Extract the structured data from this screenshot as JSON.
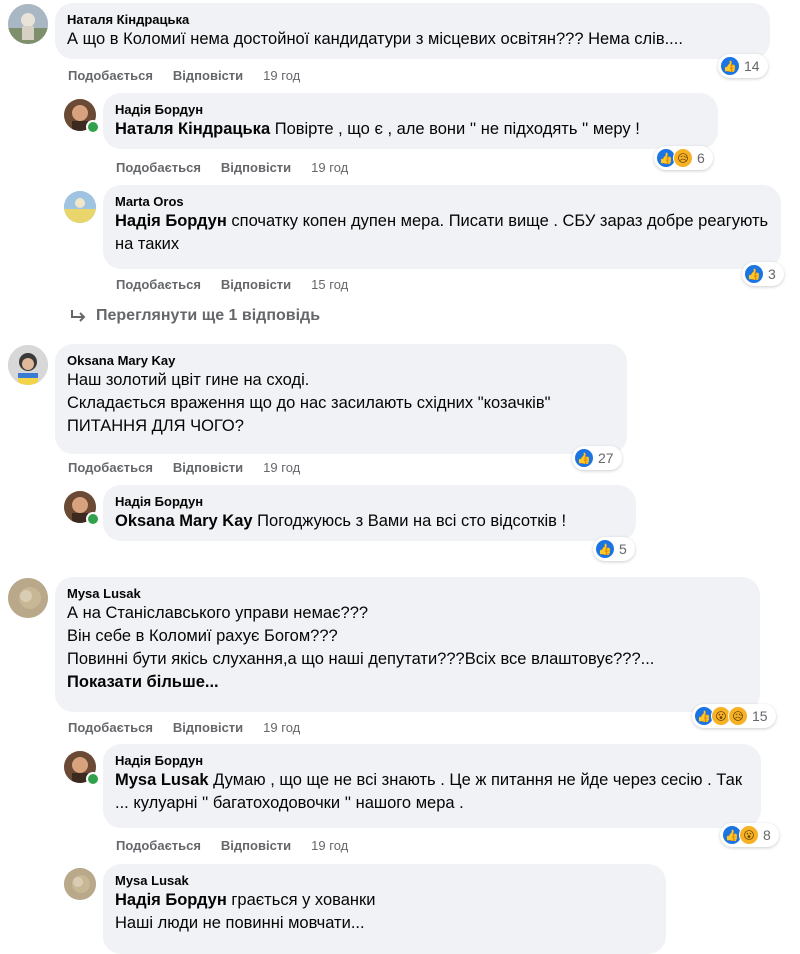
{
  "labels": {
    "like": "Подобається",
    "reply": "Відповісти"
  },
  "view_more_replies": "Переглянути ще 1 відповідь",
  "see_more": "Показати більше...",
  "comments": [
    {
      "author": "Наталя Кіндрацька",
      "text": "А що в Коломиї нема достойної кандидатури з місцевих освітян??? Нема слів....",
      "time": "19 год",
      "reactions": [
        "like"
      ],
      "reaction_count": "14"
    },
    {
      "author": "Надія Бордун",
      "mention": "Наталя Кіндрацька",
      "text": " Повірте , що є , але вони '' не підходять '' меру !",
      "time": "19 год",
      "reactions": [
        "like",
        "sad"
      ],
      "reaction_count": "6"
    },
    {
      "author": "Marta Oros",
      "mention": "Надія Бордун",
      "text": " спочатку копен дупен мера. Писати вище . СБУ зараз добре реагують на таких",
      "time": "15 год",
      "reactions": [
        "like"
      ],
      "reaction_count": "3"
    },
    {
      "author": "Oksana Mary Kay",
      "text": "Наш золотий цвіт гине на сході.\nСкладається враження що до нас засилають східних \"козачків\"\nПИТАННЯ ДЛЯ ЧОГО?",
      "time": "19 год",
      "reactions": [
        "like"
      ],
      "reaction_count": "27"
    },
    {
      "author": "Надія Бордун",
      "mention": "Oksana Mary Kay",
      "text": " Погоджуюсь з Вами на всі сто відсотків !",
      "reactions": [
        "like"
      ],
      "reaction_count": "5"
    },
    {
      "author": "Mysa Lusak",
      "text": "А на Станіславського управи немає???\nВін себе в Коломиї рахує Богом???\nПовинні бути якісь слухання,а що наші депутати???Всіх все влаштовує???...",
      "time": "19 год",
      "reactions": [
        "like",
        "wow",
        "sad"
      ],
      "reaction_count": "15"
    },
    {
      "author": "Надія Бордун",
      "mention": "Mysa Lusak",
      "text": " Думаю , що ще не всі знають . Це ж питання не йде через сесію . Так ... кулуарні '' багатоходовочки '' нашого мера .",
      "time": "19 год",
      "reactions": [
        "like",
        "wow"
      ],
      "reaction_count": "8"
    },
    {
      "author": "Mysa Lusak",
      "mention": "Надія Бордун",
      "text": " грається у хованки\nНаші люди не повинні мовчати..."
    }
  ]
}
